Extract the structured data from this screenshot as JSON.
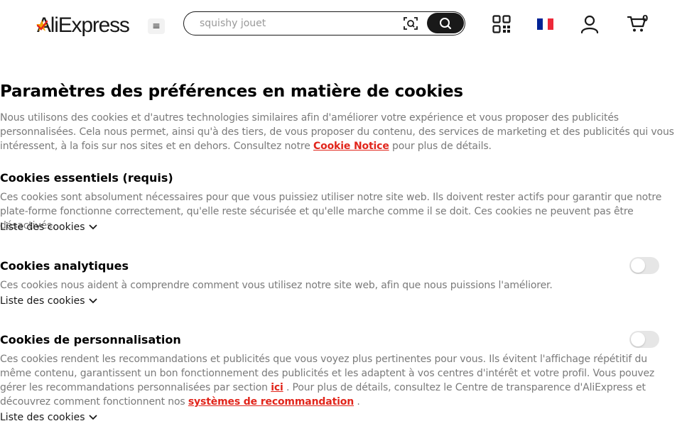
{
  "header": {
    "logo_text": "AliExpress",
    "menu_icon": "≡",
    "search_placeholder": "squishy jouet",
    "cart_count": "0"
  },
  "colors": {
    "accent": "#e1251b",
    "dark": "#191919",
    "muted": "#7a7a7a",
    "toggle_off": "#e6e6e6",
    "flag": [
      "#002395",
      "#ffffff",
      "#ed2939"
    ]
  },
  "icons": [
    "logo-star-icon",
    "menu-icon",
    "camera-search-icon",
    "search-icon",
    "qr-code-icon",
    "france-flag-icon",
    "user-icon",
    "cart-icon",
    "chevron-down-icon"
  ],
  "page": {
    "title": "Paramètres des préférences en matière de cookies",
    "intro_before": "Nous utilisons des cookies et d'autres technologies similaires afin d'améliorer votre expérience et vous proposer des publicités personnalisées. Cela nous permet, ainsi qu'à des tiers, de vous proposer du contenu, des services de marketing et des publicités qui vous intéressent, à la fois sur nos sites et en dehors. Consultez notre ",
    "intro_link": "Cookie Notice",
    "intro_after": " pour plus de détails."
  },
  "sections": [
    {
      "title": "Cookies essentiels (requis)",
      "desc": "Ces cookies sont absolument nécessaires pour que vous puissiez utiliser notre site web. Ils doivent rester actifs pour garantir que notre plate-forme fonctionne correctement, qu'elle reste sécurisée et qu'elle marche comme il se doit. Ces cookies ne peuvent pas être désactivés.",
      "list_label": "Liste des cookies"
    },
    {
      "title": "Cookies analytiques",
      "desc": "Ces cookies nous aident à comprendre comment vous utilisez notre site web, afin que nous puissions l'améliorer.",
      "list_label": "Liste des cookies",
      "toggle_on": false
    },
    {
      "title": "Cookies de personnalisation",
      "desc_part1": "Ces cookies rendent les recommandations et publicités que vous voyez plus pertinentes pour vous. Ils évitent l'affichage répétitif du même contenu, garantissent un bon fonctionnement des publicités et les adaptent à vos centres d'intérêt et votre profil. Vous pouvez gérer les recommandations personnalisées par section ",
      "link1": "ici",
      "desc_part2": " . Pour plus de détails, consultez le Centre de transparence d'AliExpress et découvrez comment fonctionnent nos ",
      "link2": "systèmes de recommandation",
      "desc_part3": " .",
      "list_label": "Liste des cookies",
      "toggle_on": false
    }
  ]
}
